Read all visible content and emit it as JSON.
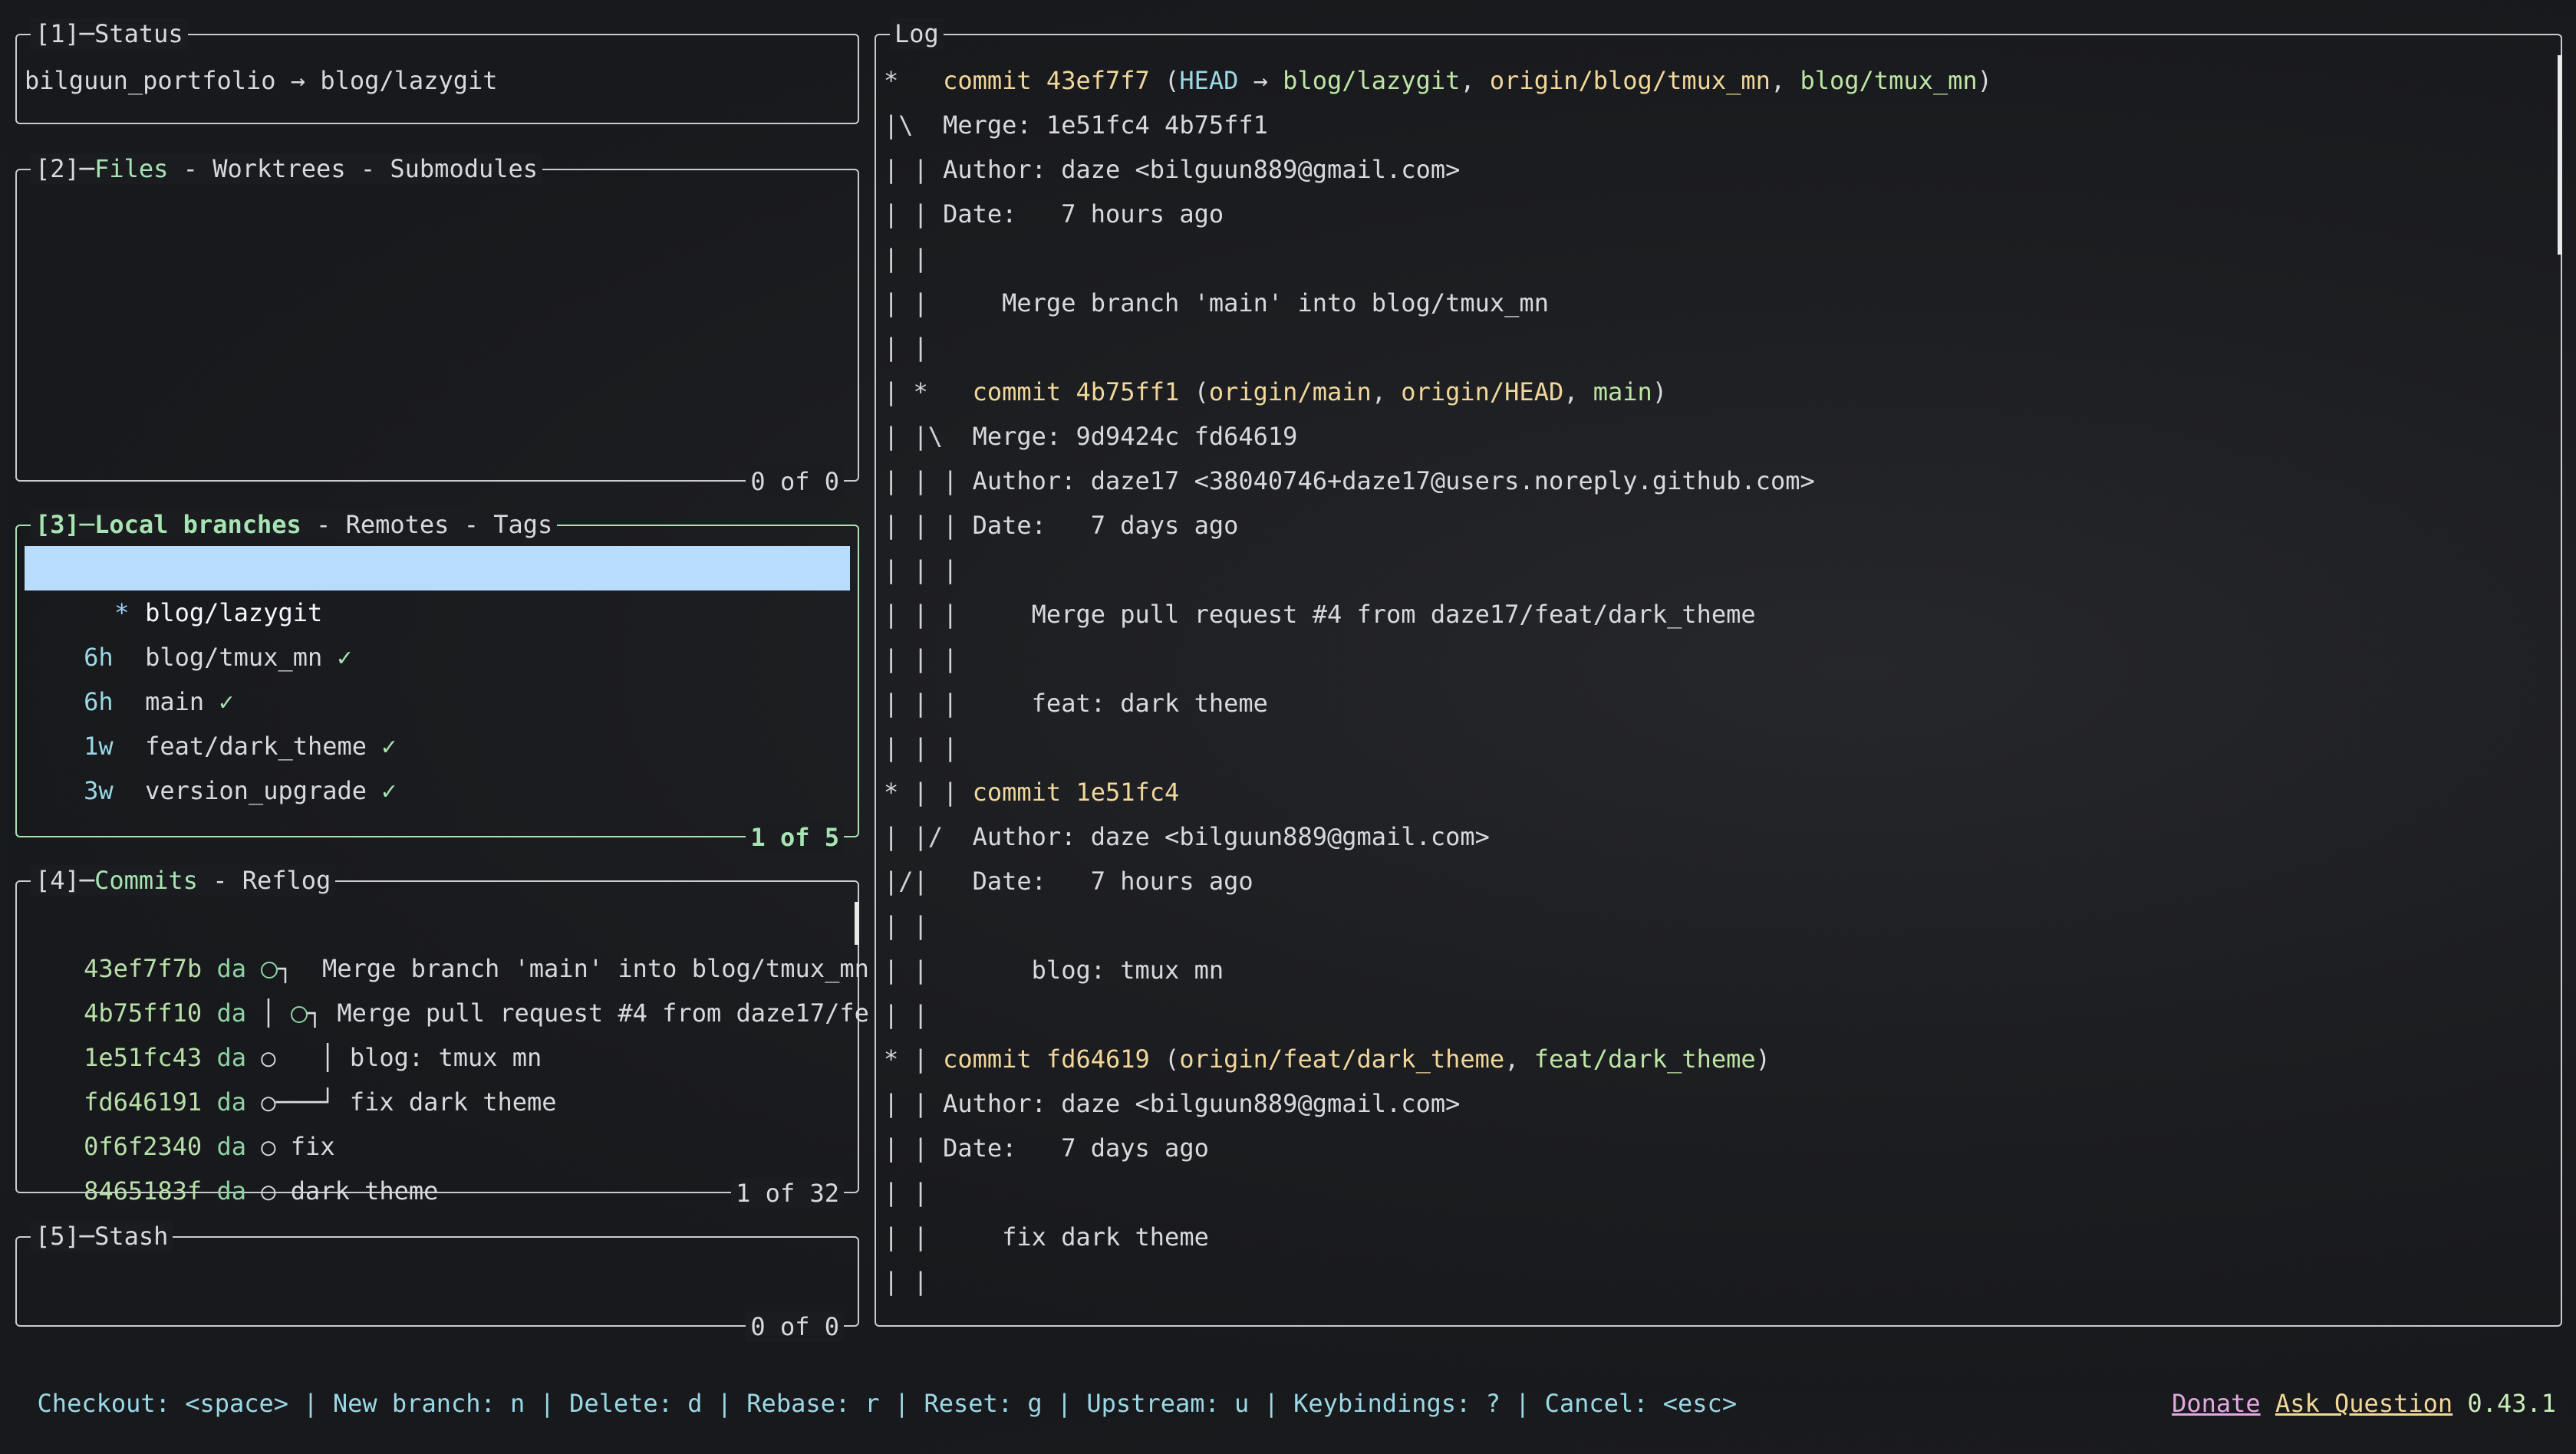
{
  "status_panel": {
    "title_num": "[1]",
    "title_label": "Status",
    "text": "bilguun_portfolio → blog/lazygit"
  },
  "files_panel": {
    "title_num": "[2]",
    "tab_active": "Files",
    "tab_2": "Worktrees",
    "tab_3": "Submodules",
    "footer": "0 of 0"
  },
  "branches_panel": {
    "title_num": "[3]",
    "tab_active": "Local branches",
    "tab_2": "Remotes",
    "tab_3": "Tags",
    "footer": "1 of 5",
    "items": [
      {
        "age": "",
        "star": "*",
        "name": "blog/lazygit",
        "check": ""
      },
      {
        "age": "6h",
        "star": "",
        "name": "blog/tmux_mn",
        "check": "✓"
      },
      {
        "age": "6h",
        "star": "",
        "name": "main",
        "check": "✓"
      },
      {
        "age": "1w",
        "star": "",
        "name": "feat/dark_theme",
        "check": "✓"
      },
      {
        "age": "3w",
        "star": "",
        "name": "version_upgrade",
        "check": "✓"
      }
    ]
  },
  "commits_panel": {
    "title_num": "[4]",
    "tab_active": "Commits",
    "tab_2": "Reflog",
    "footer": "1 of 32",
    "items": [
      {
        "sha": "43ef7f7b",
        "author": "da",
        "msg": "Merge branch 'main' into blog/tmux_mn"
      },
      {
        "sha": "4b75ff10",
        "author": "da",
        "msg": "Merge pull request #4 from daze17/fe"
      },
      {
        "sha": "1e51fc43",
        "author": "da",
        "msg": "blog: tmux mn"
      },
      {
        "sha": "fd646191",
        "author": "da",
        "msg": "fix dark theme"
      },
      {
        "sha": "0f6f2340",
        "author": "da",
        "msg": "fix"
      },
      {
        "sha": "8465183f",
        "author": "da",
        "msg": "dark theme"
      }
    ]
  },
  "stash_panel": {
    "title_num": "[5]",
    "title_label": "Stash",
    "footer": "0 of 0"
  },
  "log_panel": {
    "title": "Log",
    "lines": [
      {
        "g": "*   ",
        "parts": [
          [
            "y",
            "commit 43ef7f7 "
          ],
          [
            "w",
            "("
          ],
          [
            "c",
            "HEAD"
          ],
          [
            "w",
            " → "
          ],
          [
            "g",
            "blog/lazygit"
          ],
          [
            "w",
            ", "
          ],
          [
            "y",
            "origin/blog/tmux_mn"
          ],
          [
            "w",
            ", "
          ],
          [
            "g",
            "blog/tmux_mn"
          ],
          [
            "w",
            ")"
          ]
        ]
      },
      {
        "g": "|\\  ",
        "parts": [
          [
            "w",
            "Merge: 1e51fc4 4b75ff1"
          ]
        ]
      },
      {
        "g": "| | ",
        "parts": [
          [
            "w",
            "Author: daze <bilguun889@gmail.com>"
          ]
        ]
      },
      {
        "g": "| | ",
        "parts": [
          [
            "w",
            "Date:   7 hours ago"
          ]
        ]
      },
      {
        "g": "| |",
        "parts": []
      },
      {
        "g": "| |     ",
        "parts": [
          [
            "w",
            "Merge branch 'main' into blog/tmux_mn"
          ]
        ]
      },
      {
        "g": "| |",
        "parts": []
      },
      {
        "g": "| *   ",
        "parts": [
          [
            "y",
            "commit 4b75ff1 "
          ],
          [
            "w",
            "("
          ],
          [
            "y",
            "origin/main"
          ],
          [
            "w",
            ", "
          ],
          [
            "y",
            "origin/HEAD"
          ],
          [
            "w",
            ", "
          ],
          [
            "g",
            "main"
          ],
          [
            "w",
            ")"
          ]
        ]
      },
      {
        "g": "| |\\  ",
        "parts": [
          [
            "w",
            "Merge: 9d9424c fd64619"
          ]
        ]
      },
      {
        "g": "| | | ",
        "parts": [
          [
            "w",
            "Author: daze17 <38040746+daze17@users.noreply.github.com>"
          ]
        ]
      },
      {
        "g": "| | | ",
        "parts": [
          [
            "w",
            "Date:   7 days ago"
          ]
        ]
      },
      {
        "g": "| | |",
        "parts": []
      },
      {
        "g": "| | |     ",
        "parts": [
          [
            "w",
            "Merge pull request #4 from daze17/feat/dark_theme"
          ]
        ]
      },
      {
        "g": "| | |",
        "parts": []
      },
      {
        "g": "| | |     ",
        "parts": [
          [
            "w",
            "feat: dark theme"
          ]
        ]
      },
      {
        "g": "| | |",
        "parts": []
      },
      {
        "g": "* | | ",
        "parts": [
          [
            "y",
            "commit 1e51fc4"
          ]
        ]
      },
      {
        "g": "| |/  ",
        "parts": [
          [
            "w",
            "Author: daze <bilguun889@gmail.com>"
          ]
        ]
      },
      {
        "g": "|/|   ",
        "parts": [
          [
            "w",
            "Date:   7 hours ago"
          ]
        ]
      },
      {
        "g": "| |",
        "parts": []
      },
      {
        "g": "| |       ",
        "parts": [
          [
            "w",
            "blog: tmux mn"
          ]
        ]
      },
      {
        "g": "| |",
        "parts": []
      },
      {
        "g": "* | ",
        "parts": [
          [
            "y",
            "commit fd64619 "
          ],
          [
            "w",
            "("
          ],
          [
            "y",
            "origin/feat/dark_theme"
          ],
          [
            "w",
            ", "
          ],
          [
            "g",
            "feat/dark_theme"
          ],
          [
            "w",
            ")"
          ]
        ]
      },
      {
        "g": "| | ",
        "parts": [
          [
            "w",
            "Author: daze <bilguun889@gmail.com>"
          ]
        ]
      },
      {
        "g": "| | ",
        "parts": [
          [
            "w",
            "Date:   7 days ago"
          ]
        ]
      },
      {
        "g": "| |",
        "parts": []
      },
      {
        "g": "| |     ",
        "parts": [
          [
            "w",
            "fix dark theme"
          ]
        ]
      },
      {
        "g": "| |",
        "parts": []
      }
    ]
  },
  "status_bar": {
    "keys": "Checkout: <space> | New branch: n | Delete: d | Rebase: r | Reset: g | Upstream: u | Keybindings: ? | Cancel: <esc>",
    "donate": "Donate",
    "ask": "Ask Question",
    "version": "0.43.1"
  },
  "colors": {
    "active_border": "#a7e3b3",
    "selection": "#b8dcfb",
    "yellow": "#f1d79a",
    "cyan": "#9ad8e6"
  }
}
